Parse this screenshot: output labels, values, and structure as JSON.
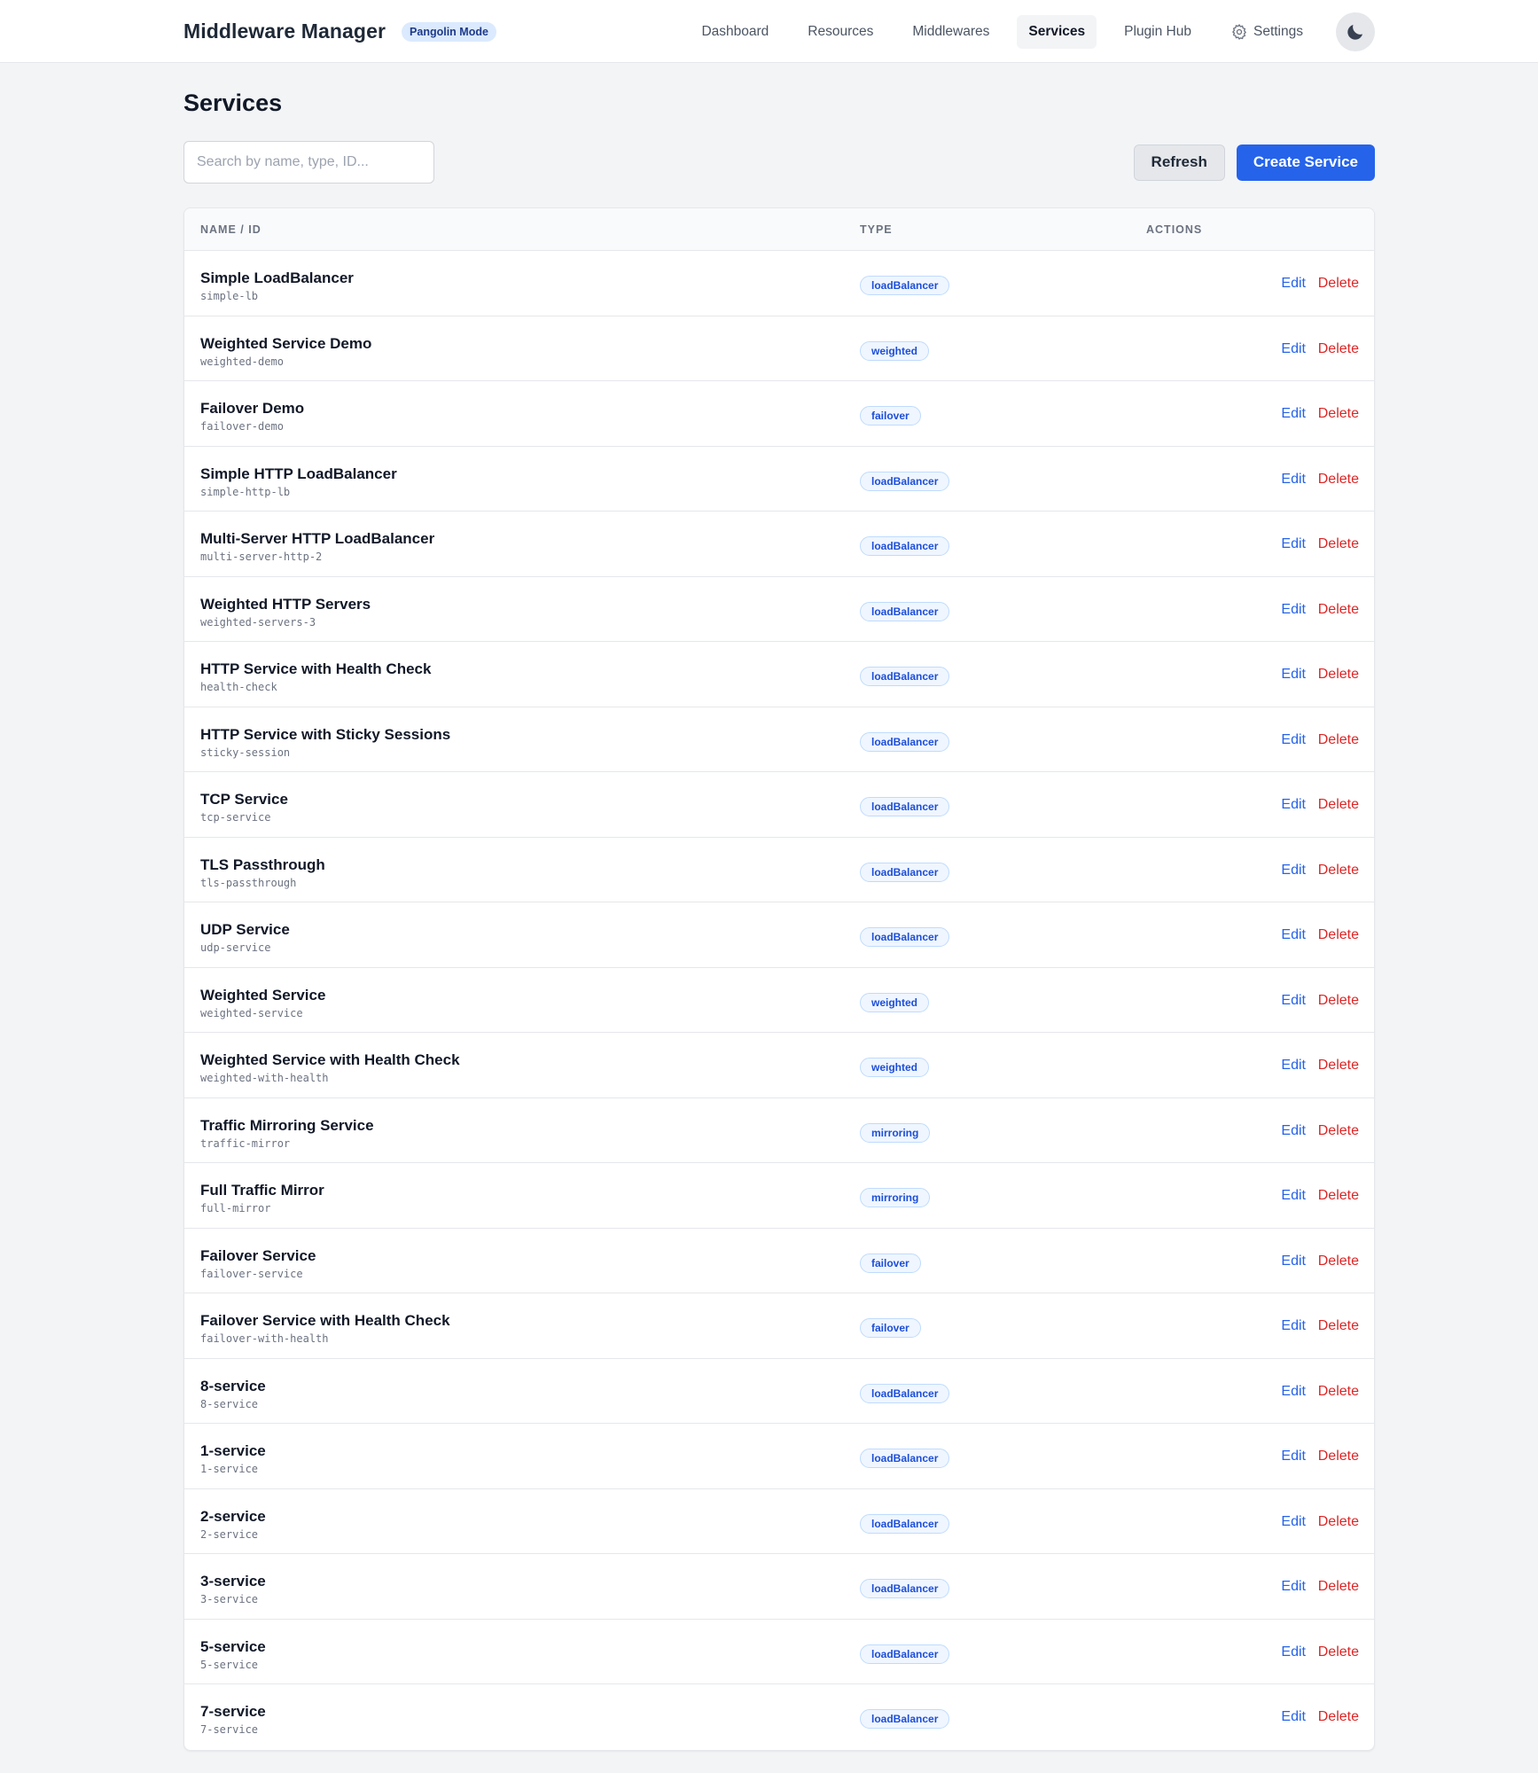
{
  "header": {
    "brand": "Middleware Manager",
    "mode_badge": "Pangolin Mode",
    "nav": [
      {
        "label": "Dashboard",
        "active": false
      },
      {
        "label": "Resources",
        "active": false
      },
      {
        "label": "Middlewares",
        "active": false
      },
      {
        "label": "Services",
        "active": true
      },
      {
        "label": "Plugin Hub",
        "active": false
      },
      {
        "label": "Settings",
        "active": false,
        "icon": "gear-icon"
      }
    ],
    "theme_toggle_icon": "moon-icon"
  },
  "page": {
    "title": "Services",
    "search": {
      "placeholder": "Search by name, type, ID...",
      "value": ""
    },
    "refresh_label": "Refresh",
    "create_label": "Create Service"
  },
  "table": {
    "columns": [
      "NAME / ID",
      "TYPE",
      "ACTIONS"
    ],
    "edit_label": "Edit",
    "delete_label": "Delete",
    "rows": [
      {
        "name": "Simple LoadBalancer",
        "id": "simple-lb",
        "type": "loadBalancer"
      },
      {
        "name": "Weighted Service Demo",
        "id": "weighted-demo",
        "type": "weighted"
      },
      {
        "name": "Failover Demo",
        "id": "failover-demo",
        "type": "failover"
      },
      {
        "name": "Simple HTTP LoadBalancer",
        "id": "simple-http-lb",
        "type": "loadBalancer"
      },
      {
        "name": "Multi-Server HTTP LoadBalancer",
        "id": "multi-server-http-2",
        "type": "loadBalancer"
      },
      {
        "name": "Weighted HTTP Servers",
        "id": "weighted-servers-3",
        "type": "loadBalancer"
      },
      {
        "name": "HTTP Service with Health Check",
        "id": "health-check",
        "type": "loadBalancer"
      },
      {
        "name": "HTTP Service with Sticky Sessions",
        "id": "sticky-session",
        "type": "loadBalancer"
      },
      {
        "name": "TCP Service",
        "id": "tcp-service",
        "type": "loadBalancer"
      },
      {
        "name": "TLS Passthrough",
        "id": "tls-passthrough",
        "type": "loadBalancer"
      },
      {
        "name": "UDP Service",
        "id": "udp-service",
        "type": "loadBalancer"
      },
      {
        "name": "Weighted Service",
        "id": "weighted-service",
        "type": "weighted"
      },
      {
        "name": "Weighted Service with Health Check",
        "id": "weighted-with-health",
        "type": "weighted"
      },
      {
        "name": "Traffic Mirroring Service",
        "id": "traffic-mirror",
        "type": "mirroring"
      },
      {
        "name": "Full Traffic Mirror",
        "id": "full-mirror",
        "type": "mirroring"
      },
      {
        "name": "Failover Service",
        "id": "failover-service",
        "type": "failover"
      },
      {
        "name": "Failover Service with Health Check",
        "id": "failover-with-health",
        "type": "failover"
      },
      {
        "name": "8-service",
        "id": "8-service",
        "type": "loadBalancer"
      },
      {
        "name": "1-service",
        "id": "1-service",
        "type": "loadBalancer"
      },
      {
        "name": "2-service",
        "id": "2-service",
        "type": "loadBalancer"
      },
      {
        "name": "3-service",
        "id": "3-service",
        "type": "loadBalancer"
      },
      {
        "name": "5-service",
        "id": "5-service",
        "type": "loadBalancer"
      },
      {
        "name": "7-service",
        "id": "7-service",
        "type": "loadBalancer"
      }
    ]
  }
}
